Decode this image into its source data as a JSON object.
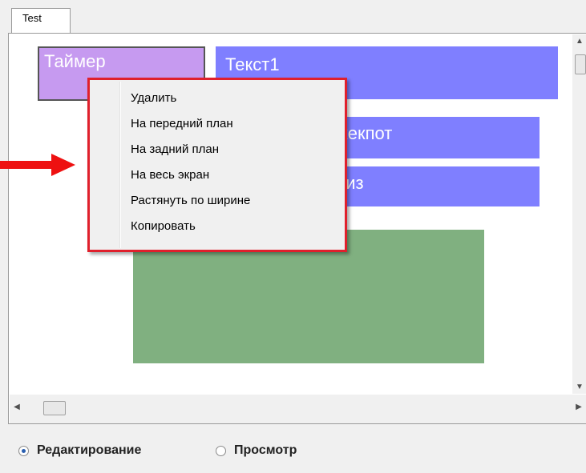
{
  "tabs": [
    {
      "label": "Test"
    }
  ],
  "canvas": {
    "widgets": {
      "timer": "Таймер",
      "text1": "Текст1",
      "jackpot": "жекпот",
      "prize": "риз",
      "image": ""
    }
  },
  "context_menu": {
    "items": [
      {
        "label": "Удалить"
      },
      {
        "label": "На передний план"
      },
      {
        "label": "На задний план"
      },
      {
        "label": "На весь экран"
      },
      {
        "label": "Растянуть по ширине"
      },
      {
        "label": "Копировать"
      }
    ],
    "highlight_color": "#e0202c"
  },
  "mode": {
    "edit_label": "Редактирование",
    "view_label": "Просмотр",
    "selected": "edit"
  },
  "colors": {
    "timer": "#c69af0",
    "text_block": "#7f7fff",
    "image_block": "#80b080",
    "annotation_arrow": "#ee1111"
  }
}
